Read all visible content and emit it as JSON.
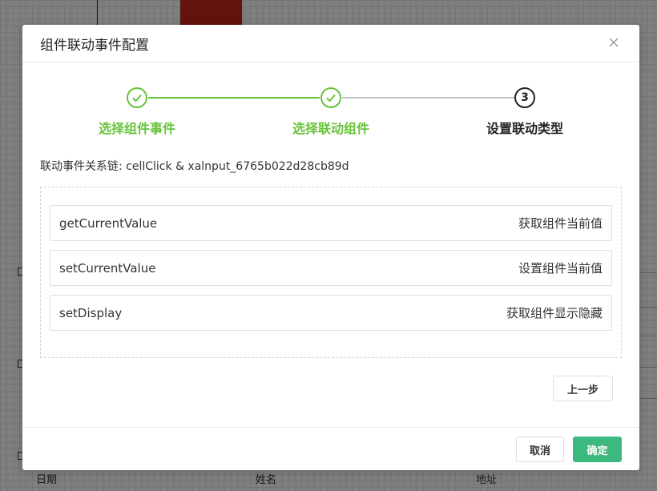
{
  "background": {
    "columns": [
      "日期",
      "姓名",
      "地址"
    ]
  },
  "dialog": {
    "title": "组件联动事件配置",
    "close_icon": "close-icon",
    "steps": [
      {
        "label": "选择组件事件",
        "status": "done"
      },
      {
        "label": "选择联动组件",
        "status": "done"
      },
      {
        "label": "设置联动类型",
        "status": "active",
        "number": "3"
      }
    ],
    "chain_text": "联动事件关系链: cellClick & xalnput_6765b022d28cb89d",
    "options": [
      {
        "name": "getCurrentValue",
        "desc": "获取组件当前值"
      },
      {
        "name": "setCurrentValue",
        "desc": "设置组件当前值"
      },
      {
        "name": "setDisplay",
        "desc": "获取组件显示隐藏"
      }
    ],
    "prev_label": "上一步",
    "cancel_label": "取消",
    "confirm_label": "确定"
  },
  "colors": {
    "step_done": "#67c23a",
    "primary_button": "#3cb97e",
    "overlay": "rgba(0,0,0,0.5)"
  }
}
